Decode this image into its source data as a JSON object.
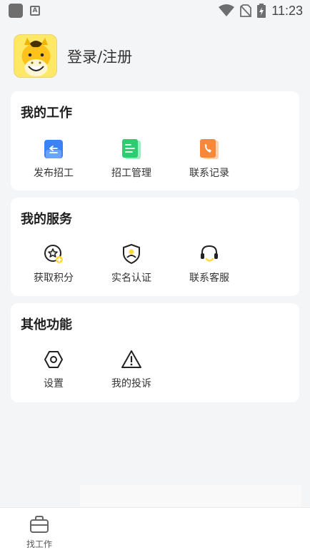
{
  "status_bar": {
    "time": "11:23"
  },
  "profile": {
    "login_label": "登录/注册"
  },
  "sections": {
    "work": {
      "title": "我的工作",
      "items": [
        {
          "label": "发布招工",
          "icon": "publish-job-icon"
        },
        {
          "label": "招工管理",
          "icon": "job-management-icon"
        },
        {
          "label": "联系记录",
          "icon": "contact-record-icon"
        }
      ]
    },
    "service": {
      "title": "我的服务",
      "items": [
        {
          "label": "获取积分",
          "icon": "points-icon"
        },
        {
          "label": "实名认证",
          "icon": "verification-icon"
        },
        {
          "label": "联系客服",
          "icon": "customer-service-icon"
        }
      ]
    },
    "other": {
      "title": "其他功能",
      "items": [
        {
          "label": "设置",
          "icon": "settings-icon"
        },
        {
          "label": "我的投诉",
          "icon": "complaint-icon"
        }
      ]
    }
  },
  "tabbar": {
    "find_job_label": "找工作"
  },
  "colors": {
    "accent_blue": "#3b82f6",
    "accent_green": "#2ecc71",
    "accent_orange": "#f5883a",
    "accent_yellow": "#ffd83a"
  }
}
